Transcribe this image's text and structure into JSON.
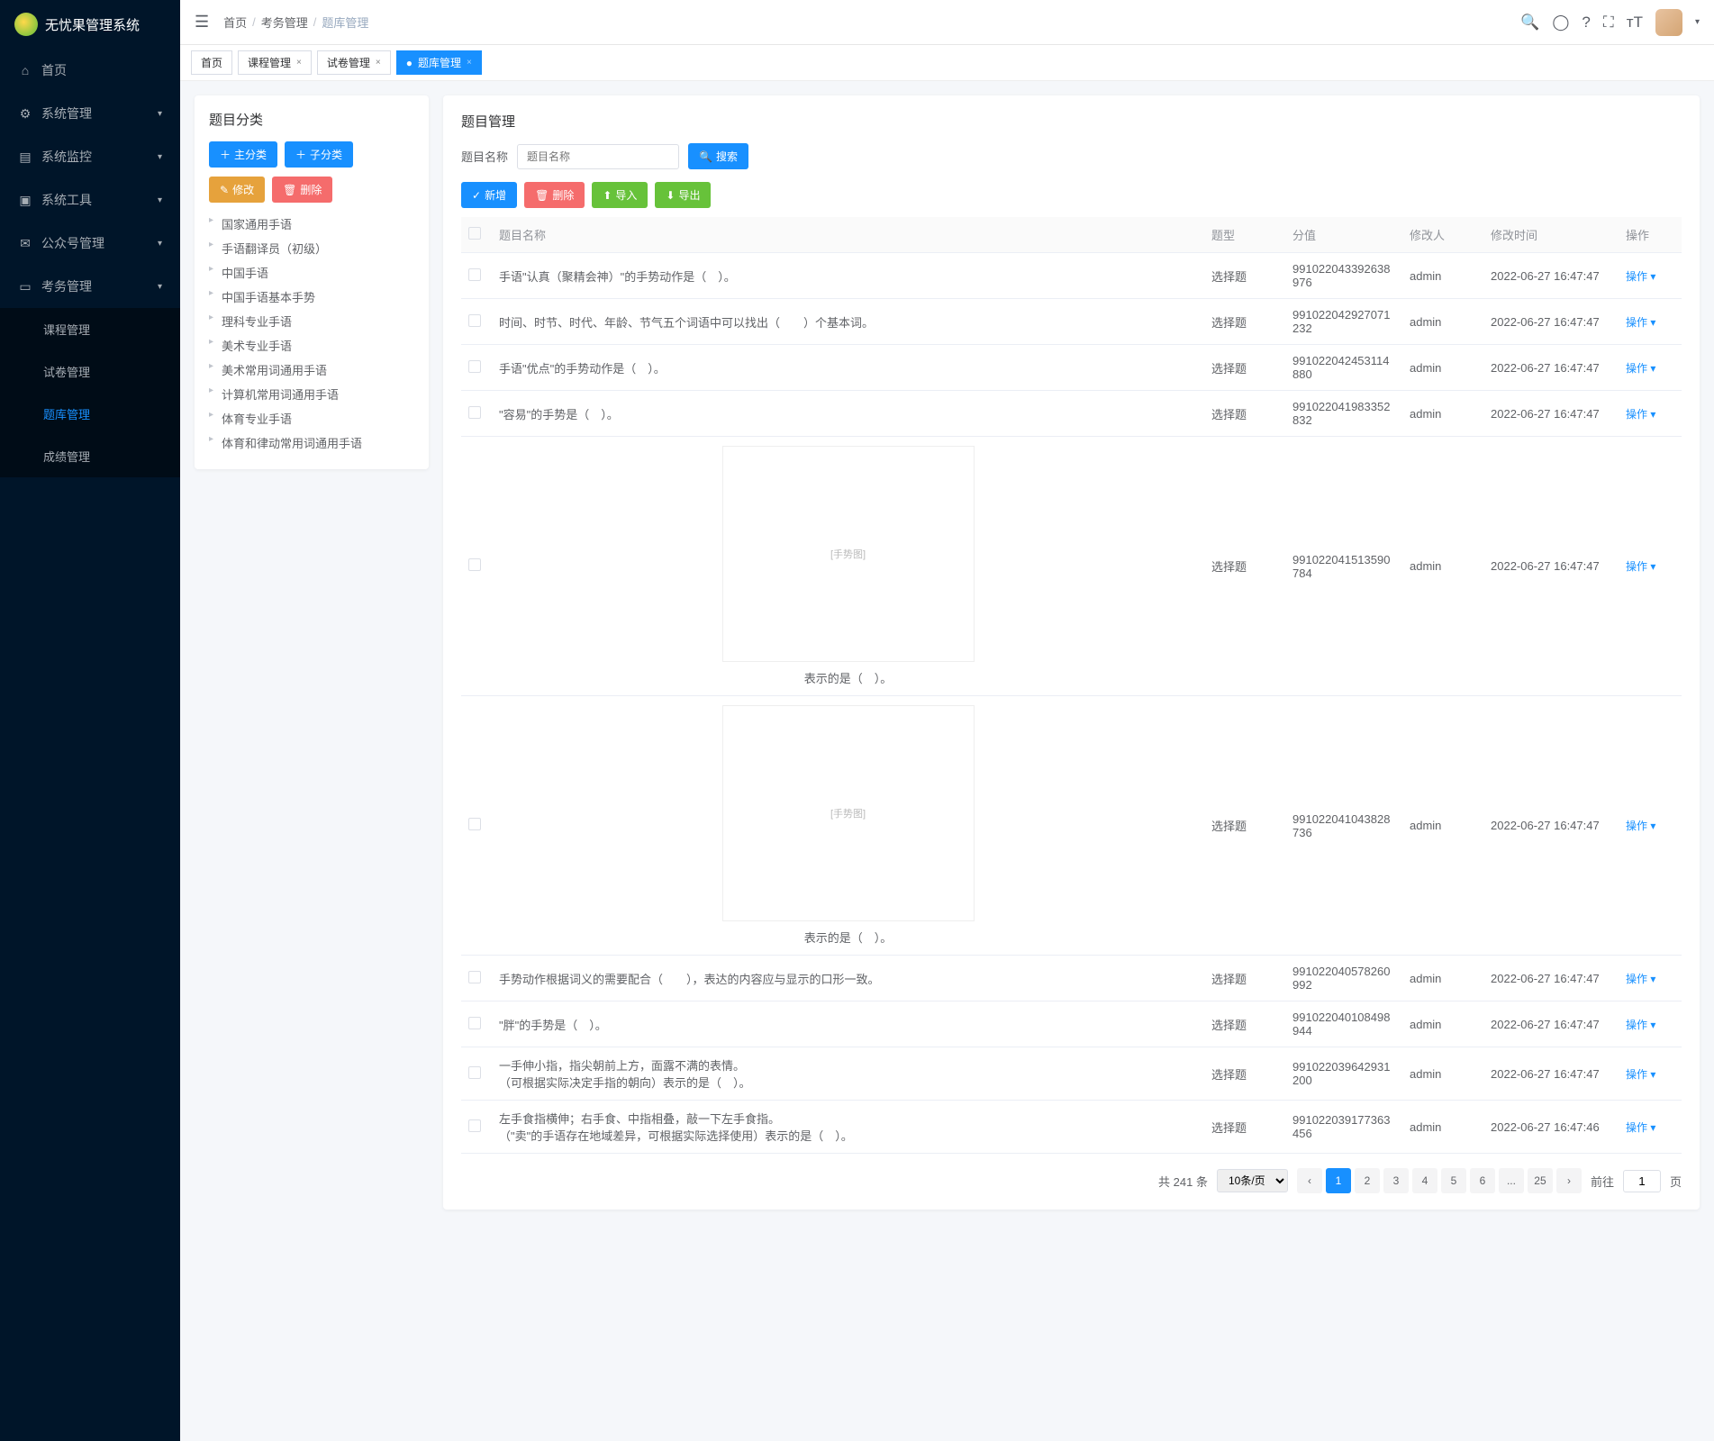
{
  "app_name": "无忧果管理系统",
  "breadcrumb": {
    "home": "首页",
    "parent": "考务管理",
    "current": "题库管理"
  },
  "sidebar": {
    "items": [
      {
        "label": "首页",
        "icon": "home"
      },
      {
        "label": "系统管理",
        "icon": "gear",
        "expandable": true
      },
      {
        "label": "系统监控",
        "icon": "monitor",
        "expandable": true
      },
      {
        "label": "系统工具",
        "icon": "tool",
        "expandable": true
      },
      {
        "label": "公众号管理",
        "icon": "wechat",
        "expandable": true
      },
      {
        "label": "考务管理",
        "icon": "book",
        "expandable": true,
        "open": true
      }
    ],
    "submenu": [
      {
        "label": "课程管理"
      },
      {
        "label": "试卷管理"
      },
      {
        "label": "题库管理",
        "active": true
      },
      {
        "label": "成绩管理"
      }
    ]
  },
  "tabs": [
    {
      "label": "首页"
    },
    {
      "label": "课程管理",
      "closable": true
    },
    {
      "label": "试卷管理",
      "closable": true
    },
    {
      "label": "题库管理",
      "closable": true,
      "active": true,
      "dot": true
    }
  ],
  "left_panel": {
    "title": "题目分类",
    "buttons": {
      "main_cat": "主分类",
      "sub_cat": "子分类",
      "edit": "修改",
      "delete": "删除"
    },
    "tree": [
      "国家通用手语",
      "手语翻译员（初级）",
      "中国手语",
      "中国手语基本手势",
      "理科专业手语",
      "美术专业手语",
      "美术常用词通用手语",
      "计算机常用词通用手语",
      "体育专业手语",
      "体育和律动常用词通用手语"
    ]
  },
  "right_panel": {
    "title": "题目管理",
    "search_label": "题目名称",
    "search_placeholder": "题目名称",
    "search_btn": "搜索",
    "toolbar": {
      "add": "新增",
      "delete": "删除",
      "import": "导入",
      "export": "导出"
    },
    "columns": [
      "题目名称",
      "题型",
      "分值",
      "修改人",
      "修改时间",
      "操作"
    ],
    "op_label": "操作",
    "rows": [
      {
        "name": "手语\"认真（聚精会神）\"的手势动作是（　）。",
        "type": "选择题",
        "score": "991022043392638976",
        "editor": "admin",
        "time": "2022-06-27 16:47:47"
      },
      {
        "name": "时间、时节、时代、年龄、节气五个词语中可以找出（　　）个基本词。",
        "type": "选择题",
        "score": "991022042927071232",
        "editor": "admin",
        "time": "2022-06-27 16:47:47"
      },
      {
        "name": "手语\"优点\"的手势动作是（　）。",
        "type": "选择题",
        "score": "991022042453114880",
        "editor": "admin",
        "time": "2022-06-27 16:47:47"
      },
      {
        "name": "\"容易\"的手势是（　）。",
        "type": "选择题",
        "score": "991022041983352832",
        "editor": "admin",
        "time": "2022-06-27 16:47:47"
      },
      {
        "name": "表示的是（　）。",
        "type": "选择题",
        "score": "991022041513590784",
        "editor": "admin",
        "time": "2022-06-27 16:47:47",
        "has_image": true
      },
      {
        "name": "表示的是（　）。",
        "type": "选择题",
        "score": "991022041043828736",
        "editor": "admin",
        "time": "2022-06-27 16:47:47",
        "has_image": true
      },
      {
        "name": "手势动作根据词义的需要配合（　　），表达的内容应与显示的口形一致。",
        "type": "选择题",
        "score": "991022040578260992",
        "editor": "admin",
        "time": "2022-06-27 16:47:47"
      },
      {
        "name": "\"胖\"的手势是（　）。",
        "type": "选择题",
        "score": "991022040108498944",
        "editor": "admin",
        "time": "2022-06-27 16:47:47"
      },
      {
        "name": "一手伸小指，指尖朝前上方，面露不满的表情。\n（可根据实际决定手指的朝向）表示的是（　）。",
        "type": "选择题",
        "score": "991022039642931200",
        "editor": "admin",
        "time": "2022-06-27 16:47:47"
      },
      {
        "name": "左手食指横伸；右手食、中指相叠，敲一下左手食指。\n（\"卖\"的手语存在地域差异，可根据实际选择使用）表示的是（　）。",
        "type": "选择题",
        "score": "991022039177363456",
        "editor": "admin",
        "time": "2022-06-27 16:47:46"
      }
    ],
    "pagination": {
      "total_text": "共 241 条",
      "per_page": "10条/页",
      "pages": [
        "1",
        "2",
        "3",
        "4",
        "5",
        "6",
        "...",
        "25"
      ],
      "current": "1",
      "goto_label": "前往",
      "goto_value": "1",
      "page_suffix": "页"
    }
  }
}
